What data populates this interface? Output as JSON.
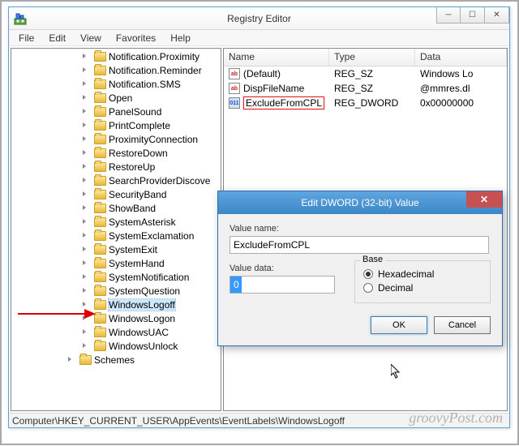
{
  "window": {
    "title": "Registry Editor"
  },
  "menu": {
    "file": "File",
    "edit": "Edit",
    "view": "View",
    "favorites": "Favorites",
    "help": "Help"
  },
  "tree": {
    "items": [
      "Notification.Proximity",
      "Notification.Reminder",
      "Notification.SMS",
      "Open",
      "PanelSound",
      "PrintComplete",
      "ProximityConnection",
      "RestoreDown",
      "RestoreUp",
      "SearchProviderDiscove",
      "SecurityBand",
      "ShowBand",
      "SystemAsterisk",
      "SystemExclamation",
      "SystemExit",
      "SystemHand",
      "SystemNotification",
      "SystemQuestion",
      "WindowsLogoff",
      "WindowsLogon",
      "WindowsUAC",
      "WindowsUnlock"
    ],
    "schemes": "Schemes",
    "selected_index": 18
  },
  "list": {
    "headers": {
      "name": "Name",
      "type": "Type",
      "data": "Data"
    },
    "rows": [
      {
        "name": "(Default)",
        "type": "REG_SZ",
        "data": "Windows Lo",
        "icon": "sz"
      },
      {
        "name": "DispFileName",
        "type": "REG_SZ",
        "data": "@mmres.dl",
        "icon": "sz"
      },
      {
        "name": "ExcludeFromCPL",
        "type": "REG_DWORD",
        "data": "0x00000000",
        "icon": "dw"
      }
    ],
    "highlighted_index": 2
  },
  "statusbar": {
    "path": "Computer\\HKEY_CURRENT_USER\\AppEvents\\EventLabels\\WindowsLogoff"
  },
  "dialog": {
    "title": "Edit DWORD (32-bit) Value",
    "value_name_label": "Value name:",
    "value_name": "ExcludeFromCPL",
    "value_data_label": "Value data:",
    "value_data": "0",
    "base_label": "Base",
    "hex_label": "Hexadecimal",
    "dec_label": "Decimal",
    "ok": "OK",
    "cancel": "Cancel"
  },
  "watermark": "groovyPost.com"
}
